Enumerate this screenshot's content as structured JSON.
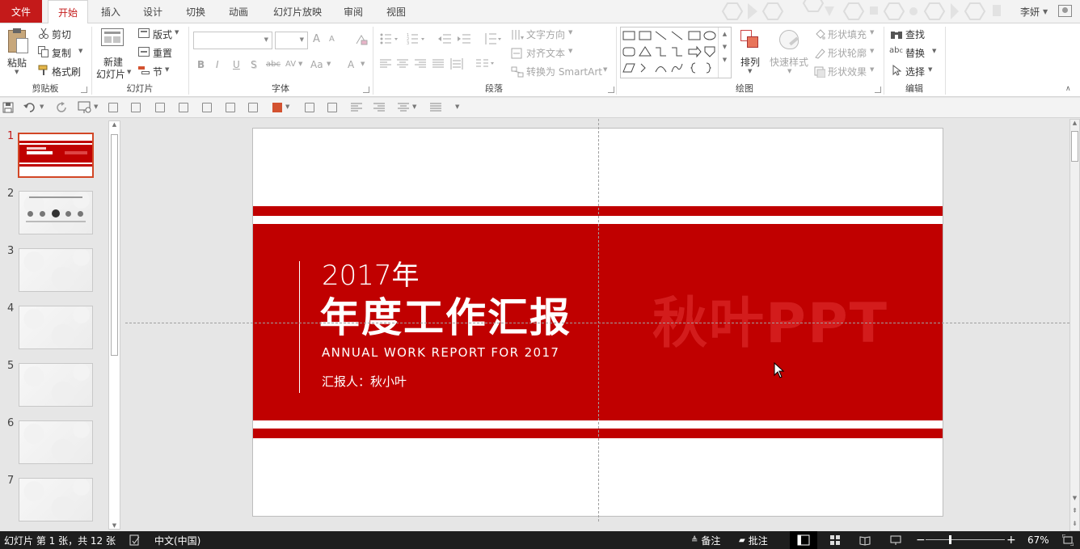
{
  "tabs": {
    "file": "文件",
    "items": [
      "开始",
      "插入",
      "设计",
      "切换",
      "动画",
      "幻灯片放映",
      "审阅",
      "视图"
    ],
    "user": "李妍"
  },
  "ribbon": {
    "clipboard": {
      "paste": "粘贴",
      "cut": "剪切",
      "copy": "复制",
      "format_painter": "格式刷",
      "label": "剪贴板"
    },
    "slides": {
      "new_slide_line1": "新建",
      "new_slide_line2": "幻灯片",
      "layout": "版式",
      "reset": "重置",
      "section": "节",
      "label": "幻灯片"
    },
    "font": {
      "label": "字体",
      "bold": "B",
      "italic": "I",
      "underline": "U",
      "shadow": "S",
      "strike": "abc",
      "spacing": "AV",
      "case": "Aa",
      "color": "A",
      "grow": "A",
      "shrink": "A"
    },
    "paragraph": {
      "label": "段落",
      "text_direction": "文字方向",
      "align_text": "对齐文本",
      "smartart": "转换为 SmartArt"
    },
    "drawing": {
      "label": "绘图",
      "arrange": "排列",
      "quick_styles": "快速样式",
      "shape_fill": "形状填充",
      "shape_outline": "形状轮廓",
      "shape_effects": "形状效果"
    },
    "editing": {
      "label": "编辑",
      "find": "查找",
      "replace": "替换",
      "select": "选择"
    }
  },
  "thumbnails": [
    {
      "num": "1",
      "active": true
    },
    {
      "num": "2",
      "active": false
    },
    {
      "num": "3",
      "active": false
    },
    {
      "num": "4",
      "active": false
    },
    {
      "num": "5",
      "active": false
    },
    {
      "num": "6",
      "active": false
    },
    {
      "num": "7",
      "active": false
    }
  ],
  "slide": {
    "year": "2017年",
    "title": "年度工作汇报",
    "subtitle": "ANNUAL WORK REPORT FOR 2017",
    "reporter": "汇报人：秋小叶",
    "watermark": "秋叶PPT"
  },
  "status": {
    "slide_info": "幻灯片 第 1 张，共 12 张",
    "language": "中文(中国)",
    "notes": "备注",
    "comments": "批注",
    "zoom": "67%"
  },
  "colors": {
    "accent": "#c41a1a",
    "slide_red": "#c00000",
    "status_bg": "#1e1e1e"
  }
}
